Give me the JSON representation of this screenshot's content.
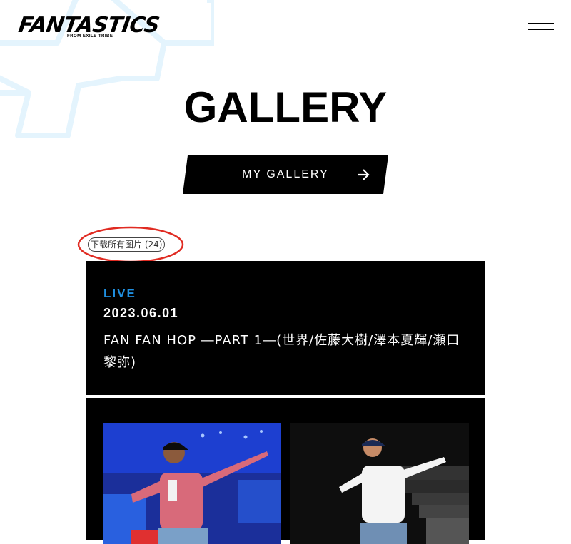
{
  "header": {
    "logo_text": "FANTASTICS",
    "logo_subtext": "FROM EXILE TRIBE",
    "menu_icon": "hamburger-menu-icon"
  },
  "page": {
    "title": "GALLERY"
  },
  "my_gallery_button": {
    "label": "MY GALLERY",
    "icon": "arrow-right-icon"
  },
  "download_all": {
    "label": "下载所有图片 (24)"
  },
  "gallery_item": {
    "category": "LIVE",
    "date": "2023.06.01",
    "title": "FAN FAN HOP ―PART 1―(世界/佐藤大樹/澤本夏輝/瀬口黎弥)"
  },
  "colors": {
    "accent_blue": "#1f8fe0",
    "annotation_red": "#e02b22",
    "card_bg": "#000000",
    "deco_star": "#e4f4fd"
  },
  "photos": [
    {
      "subject": "dancer-photo-colorful-shirt"
    },
    {
      "subject": "dancer-photo-white-shirt"
    }
  ]
}
